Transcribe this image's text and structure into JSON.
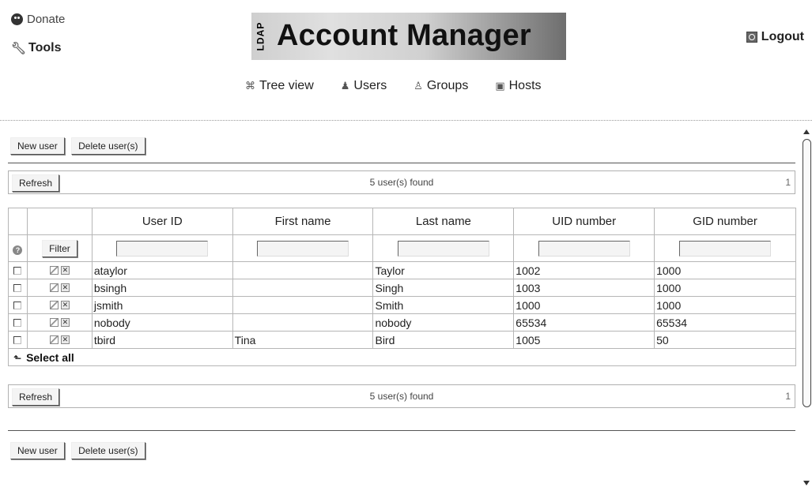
{
  "header": {
    "donate_label": "Donate",
    "tools_label": "Tools",
    "logo_ldap": "LDAP",
    "logo_title": "Account Manager",
    "logout_label": "Logout",
    "nav": [
      {
        "label": "Tree view",
        "icon": "tree-icon"
      },
      {
        "label": "Users",
        "icon": "user-icon"
      },
      {
        "label": "Groups",
        "icon": "group-icon"
      },
      {
        "label": "Hosts",
        "icon": "host-icon"
      }
    ]
  },
  "toolbar": {
    "new_user": "New user",
    "delete_users": "Delete user(s)"
  },
  "list": {
    "refresh_label": "Refresh",
    "found_text": "5 user(s) found",
    "page": "1",
    "filter_label": "Filter",
    "select_all": "Select all",
    "columns": [
      "User ID",
      "First name",
      "Last name",
      "UID number",
      "GID number"
    ],
    "rows": [
      {
        "uid": "ataylor",
        "first": "",
        "last": "Taylor",
        "uidnum": "1002",
        "gidnum": "1000"
      },
      {
        "uid": "bsingh",
        "first": "",
        "last": "Singh",
        "uidnum": "1003",
        "gidnum": "1000"
      },
      {
        "uid": "jsmith",
        "first": "",
        "last": "Smith",
        "uidnum": "1000",
        "gidnum": "1000"
      },
      {
        "uid": "nobody",
        "first": "",
        "last": "nobody",
        "uidnum": "65534",
        "gidnum": "65534"
      },
      {
        "uid": "tbird",
        "first": "Tina",
        "last": "Bird",
        "uidnum": "1005",
        "gidnum": "50"
      }
    ]
  }
}
